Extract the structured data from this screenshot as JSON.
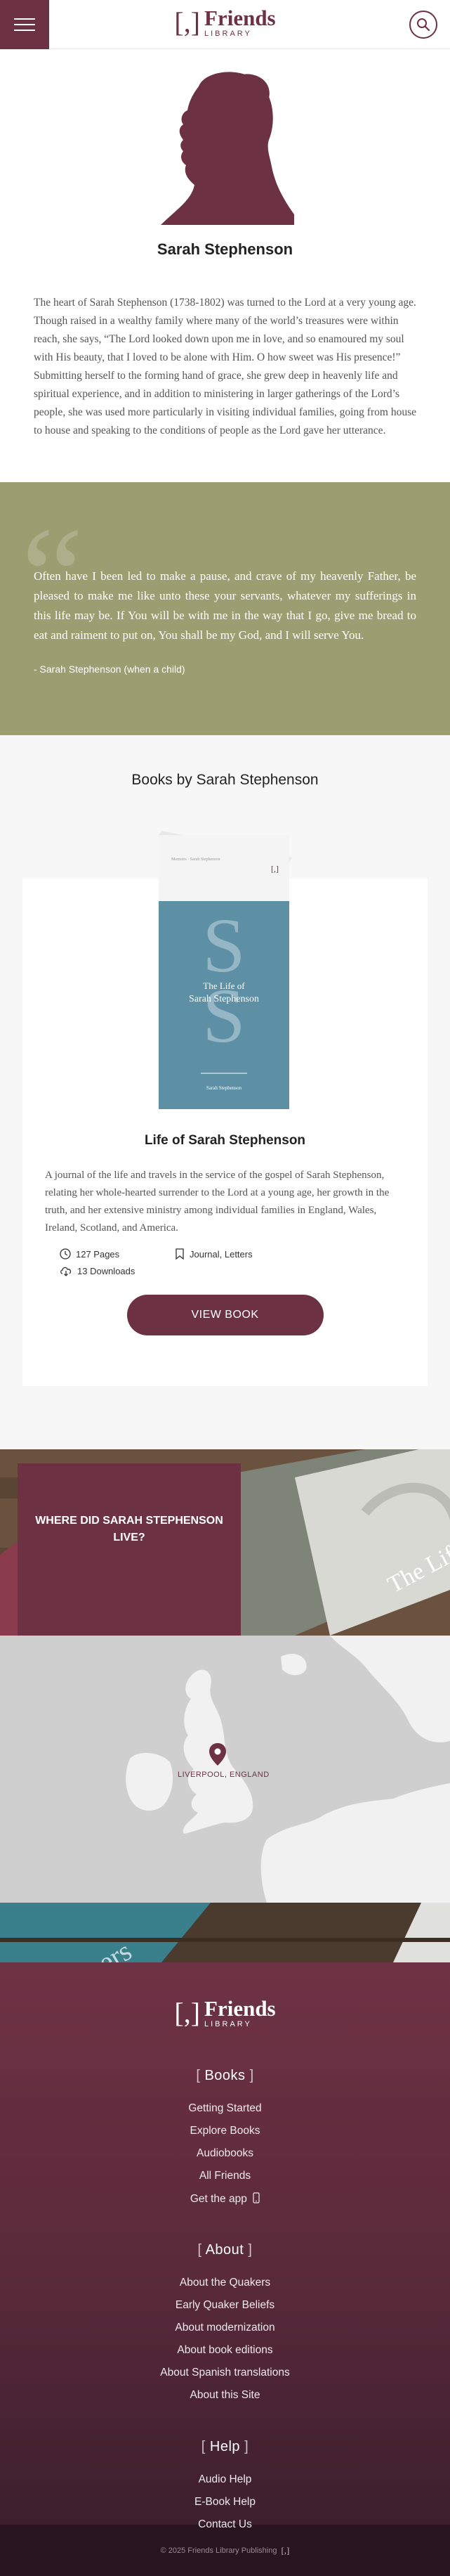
{
  "header": {
    "logo_bracket": "[,]",
    "logo_big": "Friends",
    "logo_small": "LIBRARY"
  },
  "friend": {
    "name": "Sarah Stephenson",
    "bio": "The heart of Sarah Stephenson (1738-1802) was turned to the Lord at a very young age. Though raised in a wealthy family where many of the world’s treasures were within reach, she says, “The Lord looked down upon me in love, and so enamoured my soul with His beauty, that I loved to be alone with Him. O how sweet was His presence!” Submitting herself to the forming hand of grace, she grew deep in heavenly life and spiritual experience, and in addition to ministering in larger gatherings of the Lord’s people, she was used more particularly in visiting individual families, going from house to house and speaking to the conditions of people as the Lord gave her utterance."
  },
  "quote": {
    "mark": "“",
    "text": "Often have I been led to make a pause, and crave of my heavenly Father, be pleased to make me like unto these your servants, whatever my sufferings in this life may be. If You will be with me in the way that I go, give me bread to eat and raiment to put on, You shall be my God, and I will serve You.",
    "cite": "- Sarah Stephenson (when a child)"
  },
  "books": {
    "heading": "Books by Sarah Stephenson",
    "items": [
      {
        "cover_top": "Memoirs · Sarah Stephenson",
        "cover_logo": "[,]",
        "cover_letter": "S",
        "cover_the": "The Life of",
        "cover_author": "Sarah Stephenson",
        "cover_bottom": "Sarah Stephenson",
        "title": "Life of Sarah Stephenson",
        "description": "A journal of the life and travels in the service of the gospel of Sarah Stephenson, relating her whole-hearted surrender to the Lord at a young age, her growth in the truth, and her extensive ministry among individual families in England, Wales, Ireland, Scotland, and America.",
        "pages": "127 Pages",
        "tags": "Journal, Letters",
        "downloads": "13 Downloads",
        "button": "VIEW BOOK"
      }
    ]
  },
  "where": {
    "heading": "WHERE DID SARAH STEPHENSON LIVE?",
    "banner_text": "The Life",
    "location_label": "LIVERPOOL, ENGLAND"
  },
  "footer": {
    "banner_text": "ers",
    "sections": [
      {
        "title": "Books",
        "links": [
          "Getting Started",
          "Explore Books",
          "Audiobooks",
          "All Friends",
          "Get the app"
        ]
      },
      {
        "title": "About",
        "links": [
          "About the Quakers",
          "Early Quaker Beliefs",
          "About modernization",
          "About book editions",
          "About Spanish translations",
          "About this Site"
        ]
      },
      {
        "title": "Help",
        "links": [
          "Audio Help",
          "E-Book Help",
          "Contact Us"
        ]
      }
    ],
    "copyright": "© 2025 Friends Library Publishing",
    "copyright_logo": "[,]"
  },
  "colors": {
    "brand": "#6c3142",
    "quote_band": "#9d9d72",
    "book_cover": "#5d8fa5"
  },
  "icons": [
    "menu-icon",
    "search-icon",
    "clock-icon",
    "bookmark-icon",
    "cloud-download-icon",
    "phone-icon",
    "map-pin-icon"
  ]
}
